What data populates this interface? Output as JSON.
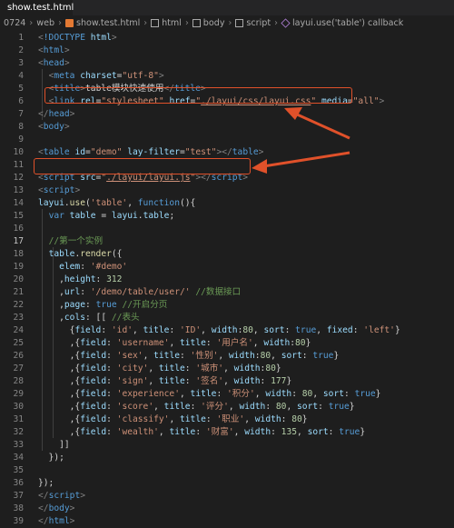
{
  "tab": {
    "label": "show.test.html"
  },
  "breadcrumb": [
    "0724",
    "web",
    "show.test.html",
    "html",
    "body",
    "script",
    "layui.use('table') callback"
  ],
  "lines": [
    {
      "n": "1",
      "tokens": [
        [
          "t-punc",
          "<"
        ],
        [
          "t-tag",
          "!DOCTYPE"
        ],
        [
          "t-text",
          " "
        ],
        [
          "t-attr",
          "html"
        ],
        [
          "t-punc",
          ">"
        ]
      ]
    },
    {
      "n": "2",
      "tokens": [
        [
          "t-punc",
          "<"
        ],
        [
          "t-tag",
          "html"
        ],
        [
          "t-punc",
          ">"
        ]
      ]
    },
    {
      "n": "3",
      "tokens": [
        [
          "t-punc",
          "<"
        ],
        [
          "t-tag",
          "head"
        ],
        [
          "t-punc",
          ">"
        ]
      ]
    },
    {
      "n": "4",
      "tokens": [
        [
          "t-text",
          "  "
        ],
        [
          "t-punc",
          "<"
        ],
        [
          "t-tag",
          "meta"
        ],
        [
          "t-text",
          " "
        ],
        [
          "t-attr",
          "charset"
        ],
        [
          "t-text",
          "="
        ],
        [
          "t-str",
          "\"utf-8\""
        ],
        [
          "t-punc",
          ">"
        ]
      ]
    },
    {
      "n": "5",
      "tokens": [
        [
          "t-text",
          "  "
        ],
        [
          "t-punc",
          "<"
        ],
        [
          "t-tag",
          "title"
        ],
        [
          "t-punc",
          ">"
        ],
        [
          "t-text",
          "table模块快速使用"
        ],
        [
          "t-punc",
          "</"
        ],
        [
          "t-tag",
          "title"
        ],
        [
          "t-punc",
          ">"
        ]
      ]
    },
    {
      "n": "6",
      "tokens": [
        [
          "t-text",
          "  "
        ],
        [
          "t-punc",
          "<"
        ],
        [
          "t-tag",
          "link"
        ],
        [
          "t-text",
          " "
        ],
        [
          "t-attr",
          "rel"
        ],
        [
          "t-text",
          "="
        ],
        [
          "t-str",
          "\"stylesheet\""
        ],
        [
          "t-text",
          " "
        ],
        [
          "t-attr",
          "href"
        ],
        [
          "t-text",
          "="
        ],
        [
          "t-str",
          "\""
        ],
        [
          "t-url",
          "./layui/css/layui.css"
        ],
        [
          "t-str",
          "\""
        ],
        [
          "t-text",
          " "
        ],
        [
          "t-attr",
          "media"
        ],
        [
          "t-text",
          "="
        ],
        [
          "t-str",
          "\"all\""
        ],
        [
          "t-punc",
          ">"
        ]
      ]
    },
    {
      "n": "7",
      "tokens": [
        [
          "t-punc",
          "</"
        ],
        [
          "t-tag",
          "head"
        ],
        [
          "t-punc",
          ">"
        ]
      ]
    },
    {
      "n": "8",
      "tokens": [
        [
          "t-punc",
          "<"
        ],
        [
          "t-tag",
          "body"
        ],
        [
          "t-punc",
          ">"
        ]
      ]
    },
    {
      "n": "9",
      "tokens": []
    },
    {
      "n": "10",
      "tokens": [
        [
          "t-punc",
          "<"
        ],
        [
          "t-tag",
          "table"
        ],
        [
          "t-text",
          " "
        ],
        [
          "t-attr",
          "id"
        ],
        [
          "t-text",
          "="
        ],
        [
          "t-str",
          "\"demo\""
        ],
        [
          "t-text",
          " "
        ],
        [
          "t-attr",
          "lay-filter"
        ],
        [
          "t-text",
          "="
        ],
        [
          "t-str",
          "\"test\""
        ],
        [
          "t-punc",
          "></"
        ],
        [
          "t-tag",
          "table"
        ],
        [
          "t-punc",
          ">"
        ]
      ]
    },
    {
      "n": "11",
      "tokens": []
    },
    {
      "n": "12",
      "tokens": [
        [
          "t-punc",
          "<"
        ],
        [
          "t-tag",
          "script"
        ],
        [
          "t-text",
          " "
        ],
        [
          "t-attr",
          "src"
        ],
        [
          "t-text",
          "="
        ],
        [
          "t-str",
          "\""
        ],
        [
          "t-url",
          "./layui/layui.js"
        ],
        [
          "t-str",
          "\""
        ],
        [
          "t-punc",
          "></"
        ],
        [
          "t-tag",
          "script"
        ],
        [
          "t-punc",
          ">"
        ]
      ]
    },
    {
      "n": "13",
      "tokens": [
        [
          "t-punc",
          "<"
        ],
        [
          "t-tag",
          "script"
        ],
        [
          "t-punc",
          ">"
        ]
      ]
    },
    {
      "n": "14",
      "tokens": [
        [
          "t-var",
          "layui"
        ],
        [
          "t-text",
          "."
        ],
        [
          "t-fn",
          "use"
        ],
        [
          "t-text",
          "("
        ],
        [
          "t-str",
          "'table'"
        ],
        [
          "t-text",
          ", "
        ],
        [
          "t-kw",
          "function"
        ],
        [
          "t-text",
          "(){"
        ]
      ]
    },
    {
      "n": "15",
      "tokens": [
        [
          "t-text",
          "  "
        ],
        [
          "t-kw",
          "var"
        ],
        [
          "t-text",
          " "
        ],
        [
          "t-var",
          "table"
        ],
        [
          "t-text",
          " = "
        ],
        [
          "t-var",
          "layui"
        ],
        [
          "t-text",
          "."
        ],
        [
          "t-var",
          "table"
        ],
        [
          "t-text",
          ";"
        ]
      ]
    },
    {
      "n": "16",
      "tokens": []
    },
    {
      "n": "17",
      "tokens": [
        [
          "t-text",
          "  "
        ],
        [
          "t-cmt",
          "//第一个实例"
        ]
      ]
    },
    {
      "n": "18",
      "tokens": [
        [
          "t-text",
          "  "
        ],
        [
          "t-var",
          "table"
        ],
        [
          "t-text",
          "."
        ],
        [
          "t-fn",
          "render"
        ],
        [
          "t-text",
          "({"
        ]
      ]
    },
    {
      "n": "19",
      "tokens": [
        [
          "t-text",
          "    "
        ],
        [
          "t-var",
          "elem"
        ],
        [
          "t-text",
          ": "
        ],
        [
          "t-str",
          "'#demo'"
        ]
      ]
    },
    {
      "n": "20",
      "tokens": [
        [
          "t-text",
          "    ,"
        ],
        [
          "t-var",
          "height"
        ],
        [
          "t-text",
          ": "
        ],
        [
          "t-num",
          "312"
        ]
      ]
    },
    {
      "n": "21",
      "tokens": [
        [
          "t-text",
          "    ,"
        ],
        [
          "t-var",
          "url"
        ],
        [
          "t-text",
          ": "
        ],
        [
          "t-str",
          "'/demo/table/user/'"
        ],
        [
          "t-text",
          " "
        ],
        [
          "t-cmt",
          "//数据接口"
        ]
      ]
    },
    {
      "n": "22",
      "tokens": [
        [
          "t-text",
          "    ,"
        ],
        [
          "t-var",
          "page"
        ],
        [
          "t-text",
          ": "
        ],
        [
          "t-kw",
          "true"
        ],
        [
          "t-text",
          " "
        ],
        [
          "t-cmt",
          "//开启分页"
        ]
      ]
    },
    {
      "n": "23",
      "tokens": [
        [
          "t-text",
          "    ,"
        ],
        [
          "t-var",
          "cols"
        ],
        [
          "t-text",
          ": [[ "
        ],
        [
          "t-cmt",
          "//表头"
        ]
      ]
    },
    {
      "n": "24",
      "tokens": [
        [
          "t-text",
          "      {"
        ],
        [
          "t-var",
          "field"
        ],
        [
          "t-text",
          ": "
        ],
        [
          "t-str",
          "'id'"
        ],
        [
          "t-text",
          ", "
        ],
        [
          "t-var",
          "title"
        ],
        [
          "t-text",
          ": "
        ],
        [
          "t-str",
          "'ID'"
        ],
        [
          "t-text",
          ", "
        ],
        [
          "t-var",
          "width"
        ],
        [
          "t-text",
          ":"
        ],
        [
          "t-num",
          "80"
        ],
        [
          "t-text",
          ", "
        ],
        [
          "t-var",
          "sort"
        ],
        [
          "t-text",
          ": "
        ],
        [
          "t-kw",
          "true"
        ],
        [
          "t-text",
          ", "
        ],
        [
          "t-var",
          "fixed"
        ],
        [
          "t-text",
          ": "
        ],
        [
          "t-str",
          "'left'"
        ],
        [
          "t-text",
          "}"
        ]
      ]
    },
    {
      "n": "25",
      "tokens": [
        [
          "t-text",
          "      ,{"
        ],
        [
          "t-var",
          "field"
        ],
        [
          "t-text",
          ": "
        ],
        [
          "t-str",
          "'username'"
        ],
        [
          "t-text",
          ", "
        ],
        [
          "t-var",
          "title"
        ],
        [
          "t-text",
          ": "
        ],
        [
          "t-str",
          "'用户名'"
        ],
        [
          "t-text",
          ", "
        ],
        [
          "t-var",
          "width"
        ],
        [
          "t-text",
          ":"
        ],
        [
          "t-num",
          "80"
        ],
        [
          "t-text",
          "}"
        ]
      ]
    },
    {
      "n": "26",
      "tokens": [
        [
          "t-text",
          "      ,{"
        ],
        [
          "t-var",
          "field"
        ],
        [
          "t-text",
          ": "
        ],
        [
          "t-str",
          "'sex'"
        ],
        [
          "t-text",
          ", "
        ],
        [
          "t-var",
          "title"
        ],
        [
          "t-text",
          ": "
        ],
        [
          "t-str",
          "'性别'"
        ],
        [
          "t-text",
          ", "
        ],
        [
          "t-var",
          "width"
        ],
        [
          "t-text",
          ":"
        ],
        [
          "t-num",
          "80"
        ],
        [
          "t-text",
          ", "
        ],
        [
          "t-var",
          "sort"
        ],
        [
          "t-text",
          ": "
        ],
        [
          "t-kw",
          "true"
        ],
        [
          "t-text",
          "}"
        ]
      ]
    },
    {
      "n": "27",
      "tokens": [
        [
          "t-text",
          "      ,{"
        ],
        [
          "t-var",
          "field"
        ],
        [
          "t-text",
          ": "
        ],
        [
          "t-str",
          "'city'"
        ],
        [
          "t-text",
          ", "
        ],
        [
          "t-var",
          "title"
        ],
        [
          "t-text",
          ": "
        ],
        [
          "t-str",
          "'城市'"
        ],
        [
          "t-text",
          ", "
        ],
        [
          "t-var",
          "width"
        ],
        [
          "t-text",
          ":"
        ],
        [
          "t-num",
          "80"
        ],
        [
          "t-text",
          "}"
        ]
      ]
    },
    {
      "n": "28",
      "tokens": [
        [
          "t-text",
          "      ,{"
        ],
        [
          "t-var",
          "field"
        ],
        [
          "t-text",
          ": "
        ],
        [
          "t-str",
          "'sign'"
        ],
        [
          "t-text",
          ", "
        ],
        [
          "t-var",
          "title"
        ],
        [
          "t-text",
          ": "
        ],
        [
          "t-str",
          "'签名'"
        ],
        [
          "t-text",
          ", "
        ],
        [
          "t-var",
          "width"
        ],
        [
          "t-text",
          ": "
        ],
        [
          "t-num",
          "177"
        ],
        [
          "t-text",
          "}"
        ]
      ]
    },
    {
      "n": "29",
      "tokens": [
        [
          "t-text",
          "      ,{"
        ],
        [
          "t-var",
          "field"
        ],
        [
          "t-text",
          ": "
        ],
        [
          "t-str",
          "'experience'"
        ],
        [
          "t-text",
          ", "
        ],
        [
          "t-var",
          "title"
        ],
        [
          "t-text",
          ": "
        ],
        [
          "t-str",
          "'积分'"
        ],
        [
          "t-text",
          ", "
        ],
        [
          "t-var",
          "width"
        ],
        [
          "t-text",
          ": "
        ],
        [
          "t-num",
          "80"
        ],
        [
          "t-text",
          ", "
        ],
        [
          "t-var",
          "sort"
        ],
        [
          "t-text",
          ": "
        ],
        [
          "t-kw",
          "true"
        ],
        [
          "t-text",
          "}"
        ]
      ]
    },
    {
      "n": "30",
      "tokens": [
        [
          "t-text",
          "      ,{"
        ],
        [
          "t-var",
          "field"
        ],
        [
          "t-text",
          ": "
        ],
        [
          "t-str",
          "'score'"
        ],
        [
          "t-text",
          ", "
        ],
        [
          "t-var",
          "title"
        ],
        [
          "t-text",
          ": "
        ],
        [
          "t-str",
          "'评分'"
        ],
        [
          "t-text",
          ", "
        ],
        [
          "t-var",
          "width"
        ],
        [
          "t-text",
          ": "
        ],
        [
          "t-num",
          "80"
        ],
        [
          "t-text",
          ", "
        ],
        [
          "t-var",
          "sort"
        ],
        [
          "t-text",
          ": "
        ],
        [
          "t-kw",
          "true"
        ],
        [
          "t-text",
          "}"
        ]
      ]
    },
    {
      "n": "31",
      "tokens": [
        [
          "t-text",
          "      ,{"
        ],
        [
          "t-var",
          "field"
        ],
        [
          "t-text",
          ": "
        ],
        [
          "t-str",
          "'classify'"
        ],
        [
          "t-text",
          ", "
        ],
        [
          "t-var",
          "title"
        ],
        [
          "t-text",
          ": "
        ],
        [
          "t-str",
          "'职业'"
        ],
        [
          "t-text",
          ", "
        ],
        [
          "t-var",
          "width"
        ],
        [
          "t-text",
          ": "
        ],
        [
          "t-num",
          "80"
        ],
        [
          "t-text",
          "}"
        ]
      ]
    },
    {
      "n": "32",
      "tokens": [
        [
          "t-text",
          "      ,{"
        ],
        [
          "t-var",
          "field"
        ],
        [
          "t-text",
          ": "
        ],
        [
          "t-str",
          "'wealth'"
        ],
        [
          "t-text",
          ", "
        ],
        [
          "t-var",
          "title"
        ],
        [
          "t-text",
          ": "
        ],
        [
          "t-str",
          "'财富'"
        ],
        [
          "t-text",
          ", "
        ],
        [
          "t-var",
          "width"
        ],
        [
          "t-text",
          ": "
        ],
        [
          "t-num",
          "135"
        ],
        [
          "t-text",
          ", "
        ],
        [
          "t-var",
          "sort"
        ],
        [
          "t-text",
          ": "
        ],
        [
          "t-kw",
          "true"
        ],
        [
          "t-text",
          "}"
        ]
      ]
    },
    {
      "n": "33",
      "tokens": [
        [
          "t-text",
          "    ]]"
        ]
      ]
    },
    {
      "n": "34",
      "tokens": [
        [
          "t-text",
          "  });"
        ]
      ]
    },
    {
      "n": "35",
      "tokens": []
    },
    {
      "n": "36",
      "tokens": [
        [
          "t-text",
          "});"
        ]
      ]
    },
    {
      "n": "37",
      "tokens": [
        [
          "t-punc",
          "</"
        ],
        [
          "t-tag",
          "script"
        ],
        [
          "t-punc",
          ">"
        ]
      ]
    },
    {
      "n": "38",
      "tokens": [
        [
          "t-punc",
          "</"
        ],
        [
          "t-tag",
          "body"
        ],
        [
          "t-punc",
          ">"
        ]
      ]
    },
    {
      "n": "39",
      "tokens": [
        [
          "t-punc",
          "</"
        ],
        [
          "t-tag",
          "html"
        ],
        [
          "t-punc",
          ">"
        ]
      ]
    }
  ],
  "annotation_color": "#e0512a",
  "icons": [
    "html-file-icon",
    "folder-icon",
    "tag-icon",
    "cube-icon"
  ]
}
